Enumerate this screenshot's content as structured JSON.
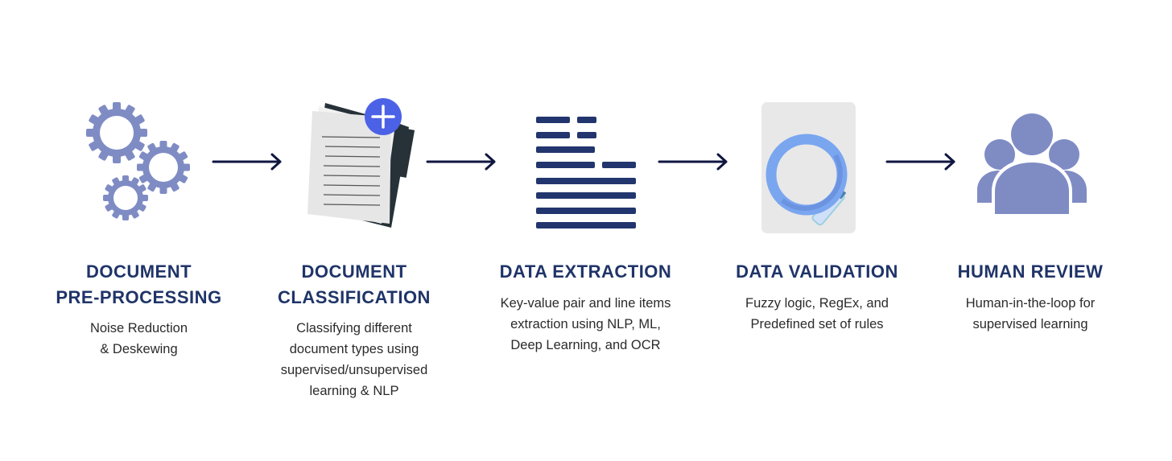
{
  "colors": {
    "title": "#1f3468",
    "arrow": "#0f1640",
    "gear": "#7f8cc4",
    "bars": "#22356e",
    "plus_badge": "#4c62e6",
    "magnifier": "#7aa6f0",
    "people": "#7f8cc4"
  },
  "steps": [
    {
      "icon": "gears-icon",
      "title": [
        "DOCUMENT",
        "PRE-PROCESSING"
      ],
      "description": [
        "Noise Reduction",
        "& Deskewing"
      ]
    },
    {
      "icon": "document-add-icon",
      "title": [
        "DOCUMENT",
        "CLASSIFICATION"
      ],
      "description": [
        "Classifying different",
        "document types using",
        "supervised/unsupervised",
        "learning & NLP"
      ]
    },
    {
      "icon": "text-lines-icon",
      "title": [
        "DATA EXTRACTION"
      ],
      "description": [
        "Key-value pair and line items",
        "extraction using NLP, ML,",
        "Deep Learning, and OCR"
      ]
    },
    {
      "icon": "magnifier-document-icon",
      "title": [
        "DATA VALIDATION"
      ],
      "description": [
        "Fuzzy logic, RegEx, and",
        "Predefined set of rules"
      ]
    },
    {
      "icon": "people-group-icon",
      "title": [
        "HUMAN REVIEW"
      ],
      "description": [
        "Human-in-the-loop for",
        "supervised learning"
      ]
    }
  ]
}
